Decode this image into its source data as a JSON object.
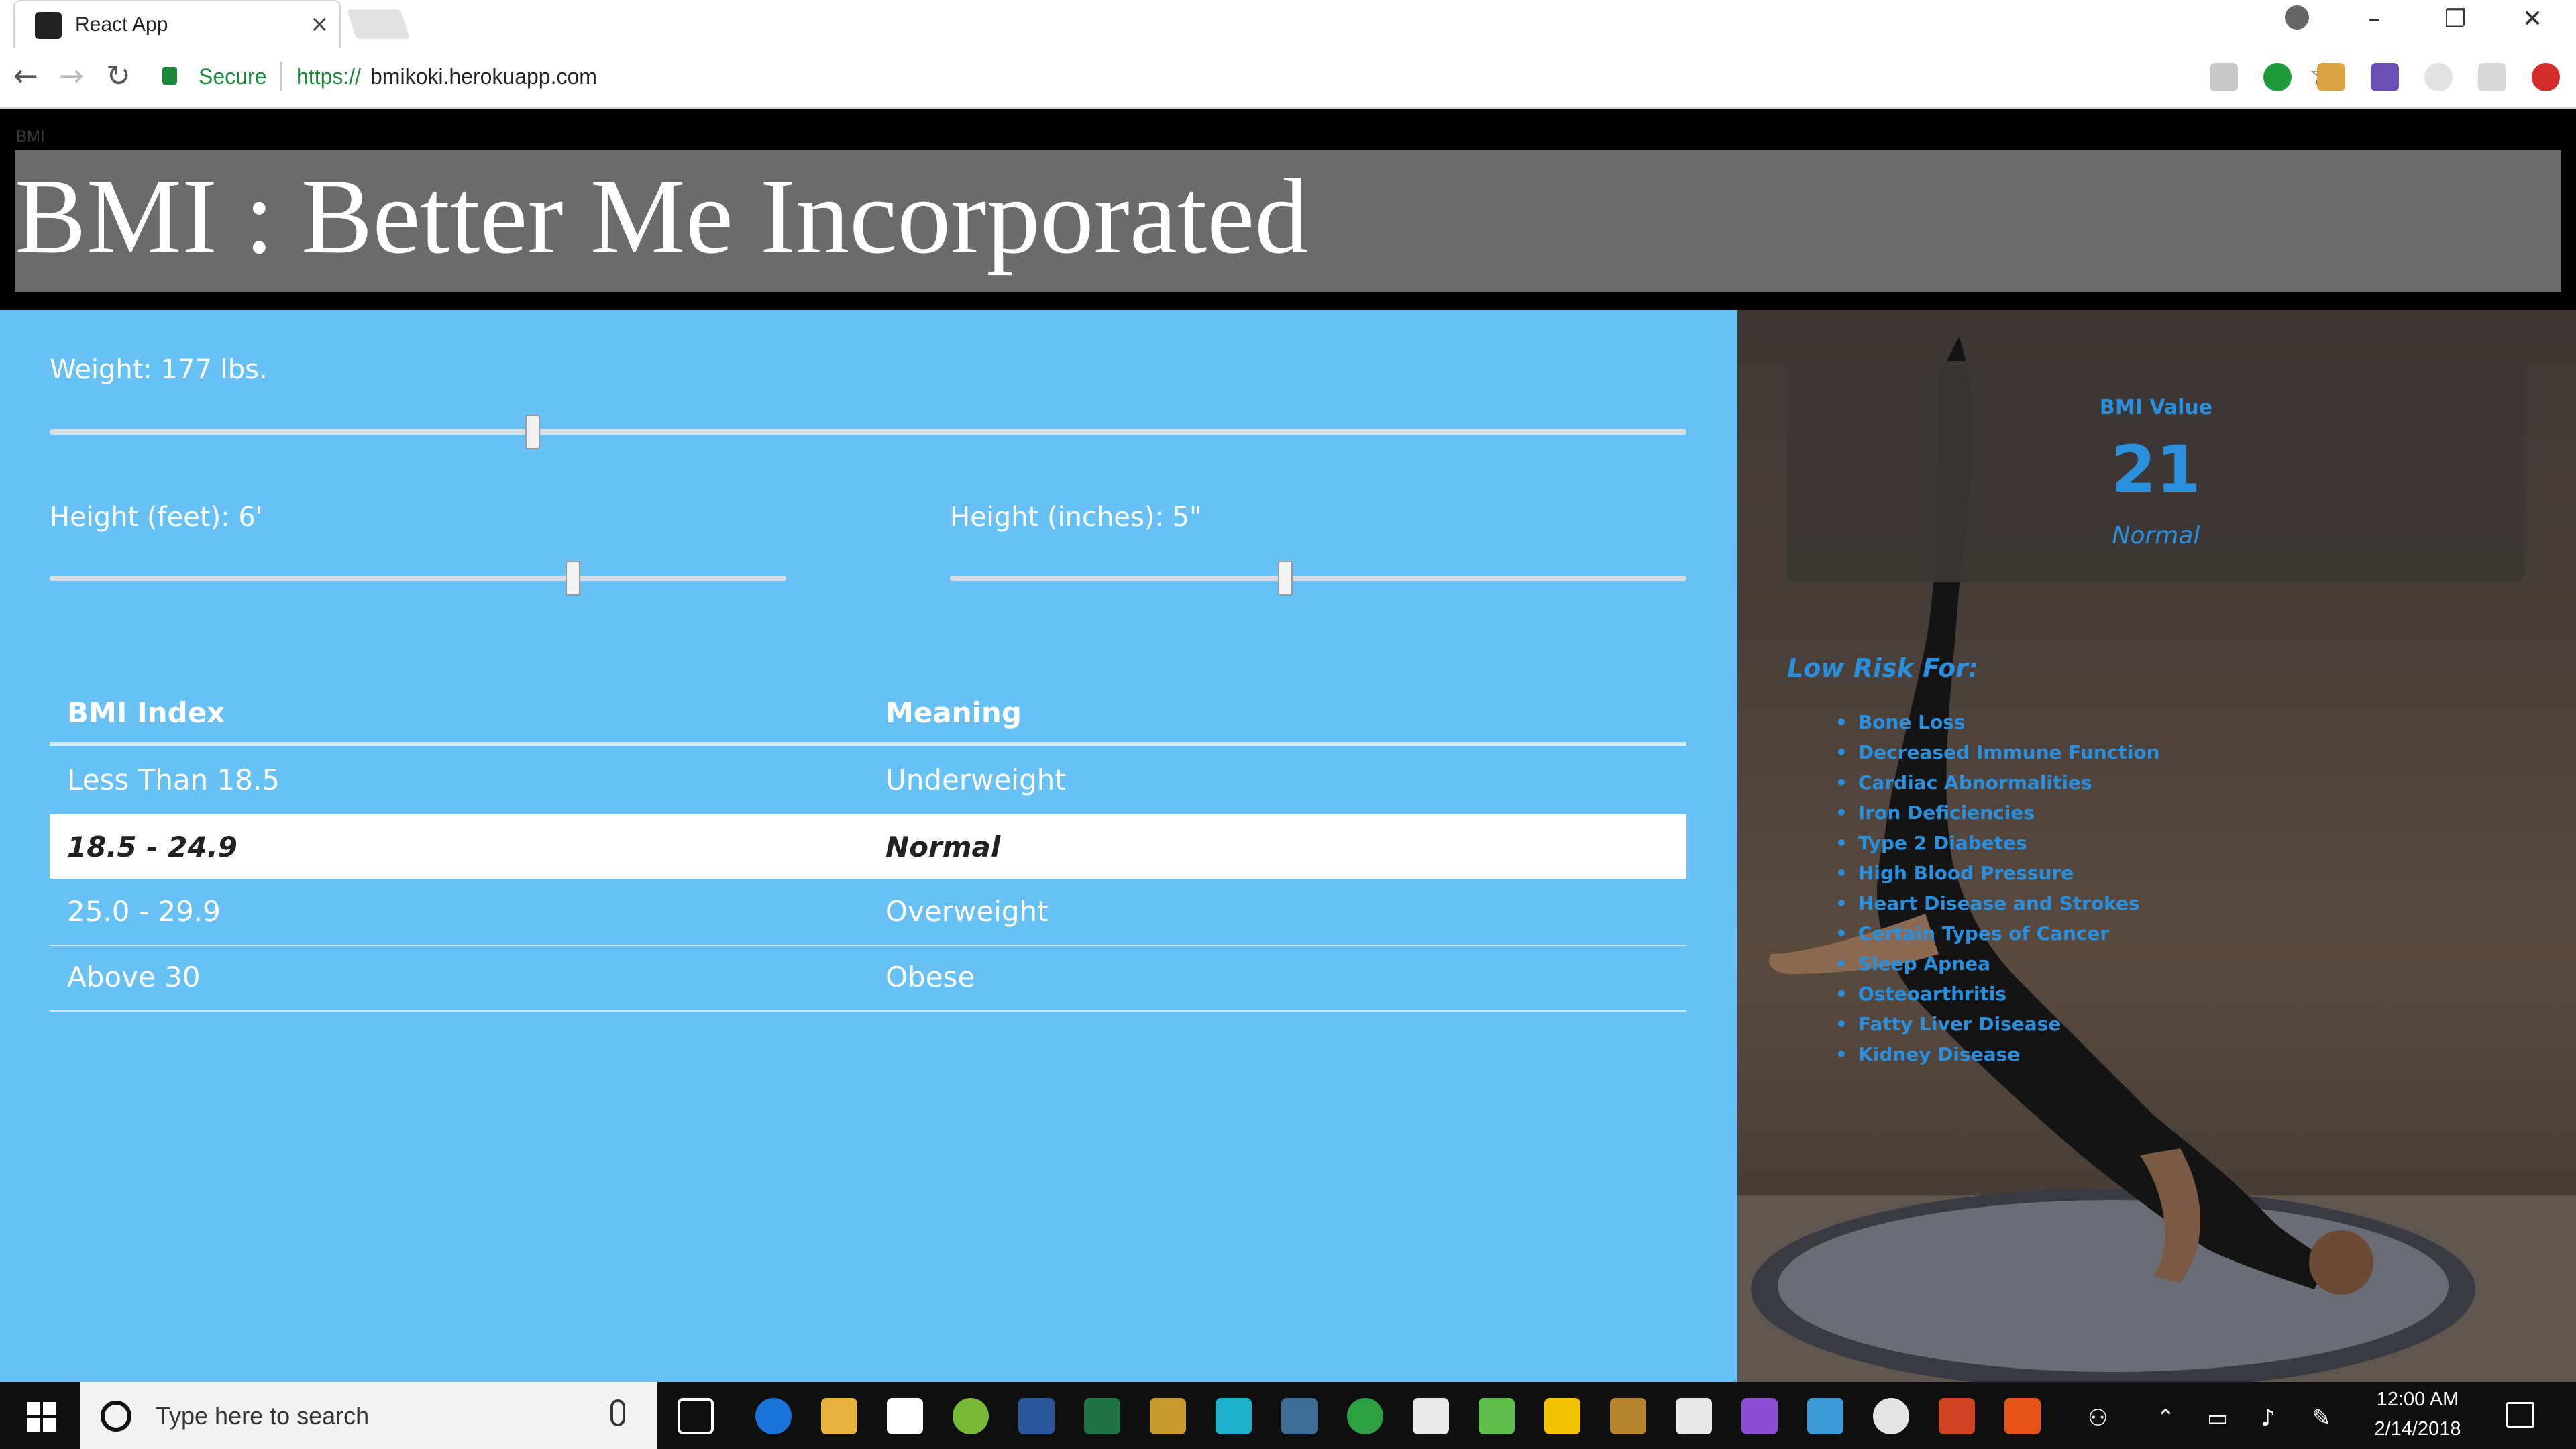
{
  "browser": {
    "tab_title": "React App",
    "tab_close": "×",
    "secure_label": "Secure",
    "url_scheme": "https://",
    "url_host": "bmikoki.herokuapp.com",
    "back_icon": "←",
    "forward_icon": "→",
    "reload_icon": "↻",
    "star_icon": "☆",
    "minimize_icon": "–",
    "restore_icon": "❐",
    "close_icon": "✕"
  },
  "page": {
    "small_label": "BMI",
    "title": "BMI : Better Me Incorporated"
  },
  "controls": {
    "weight_label": "Weight: 177 lbs.",
    "weight_value": 0.295,
    "height_feet_label": "Height (feet): 6'",
    "height_feet_value": 0.71,
    "height_inches_label": "Height (inches): 5\"",
    "height_inches_value": 0.455
  },
  "table": {
    "headers": [
      "BMI Index",
      "Meaning"
    ],
    "rows": [
      {
        "index": "Less Than 18.5",
        "meaning": "Underweight"
      },
      {
        "index": "18.5 - 24.9",
        "meaning": "Normal"
      },
      {
        "index": "25.0 - 29.9",
        "meaning": "Overweight"
      },
      {
        "index": "Above 30",
        "meaning": "Obese"
      }
    ]
  },
  "result": {
    "label": "BMI Value",
    "value": "21",
    "status": "Normal",
    "accent_color": "#2a90dd"
  },
  "risks": {
    "title": "Low Risk For:",
    "items": [
      "Bone Loss",
      "Decreased Immune Function",
      "Cardiac Abnormalities",
      "Iron Deficiencies",
      "Type 2 Diabetes",
      "High Blood Pressure",
      "Heart Disease and Strokes",
      "Certain Types of Cancer",
      "Sleep Apnea",
      "Osteoarthritis",
      "Fatty Liver Disease",
      "Kidney Disease"
    ]
  },
  "taskbar": {
    "search_placeholder": "Type here to search",
    "time": "12:00 AM",
    "date": "2/14/2018"
  },
  "colors": {
    "panel_blue": "#67c1f5",
    "banner_gray": "#6b6b6b"
  }
}
